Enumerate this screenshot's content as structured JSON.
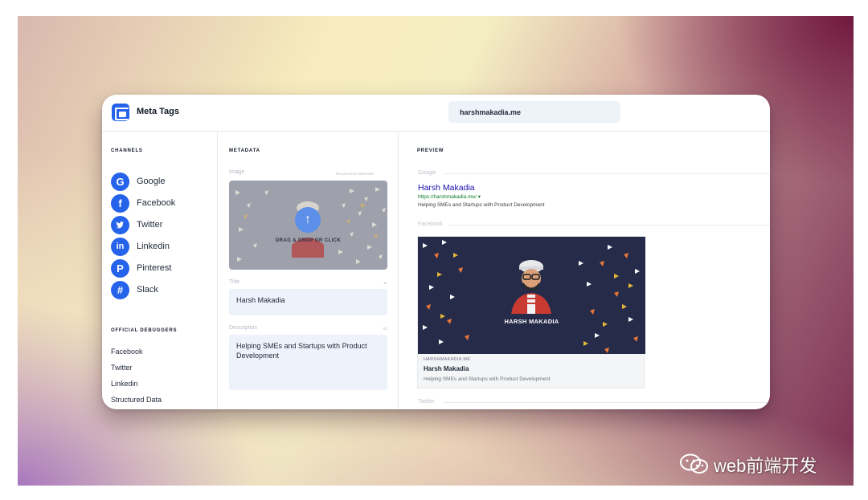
{
  "app": {
    "title": "Meta Tags",
    "url": "harshmakadia.me"
  },
  "channels": {
    "heading": "CHANNELS",
    "items": [
      {
        "label": "Google",
        "icon": "google-icon",
        "glyph": "G"
      },
      {
        "label": "Facebook",
        "icon": "facebook-icon",
        "glyph": "f"
      },
      {
        "label": "Twitter",
        "icon": "twitter-icon",
        "glyph": "t"
      },
      {
        "label": "Linkedin",
        "icon": "linkedin-icon",
        "glyph": "in"
      },
      {
        "label": "Pinterest",
        "icon": "pinterest-icon",
        "glyph": "P"
      },
      {
        "label": "Slack",
        "icon": "slack-icon",
        "glyph": "#"
      }
    ]
  },
  "debuggers": {
    "heading": "OFFICIAL DEBUGGERS",
    "items": [
      "Facebook",
      "Twitter",
      "Linkedin",
      "Structured Data"
    ]
  },
  "metadata": {
    "heading": "METADATA",
    "image": {
      "label": "Image",
      "hint": "Recommend 1200×628",
      "drop_text": "DRAG & DROP OR CLICK"
    },
    "title": {
      "label": "Title",
      "counter": "11",
      "value": "Harsh Makadia"
    },
    "description": {
      "label": "Description",
      "counter": "61",
      "value": "Helping SMEs and Startups with Product Development"
    }
  },
  "preview": {
    "heading": "PREVIEW",
    "google": {
      "label": "Google",
      "title": "Harsh Makadia",
      "url": "https://harshmakadia.me/",
      "description": "Helping SMEs and Startups with Product Development"
    },
    "facebook": {
      "label": "Facebook",
      "image_caption": "HARSH MAKADIA",
      "domain": "HARSHMAKADIA.ME",
      "title": "Harsh Makadia",
      "description": "Helping SMEs and Startups with Product Development"
    },
    "twitter": {
      "label": "Twitter"
    }
  },
  "watermark": {
    "text": "web前端开发"
  },
  "colors": {
    "accent": "#2563eb",
    "google_link": "#1a0dab",
    "google_url": "#0b7a24",
    "fb_image_bg": "#262b4a"
  }
}
